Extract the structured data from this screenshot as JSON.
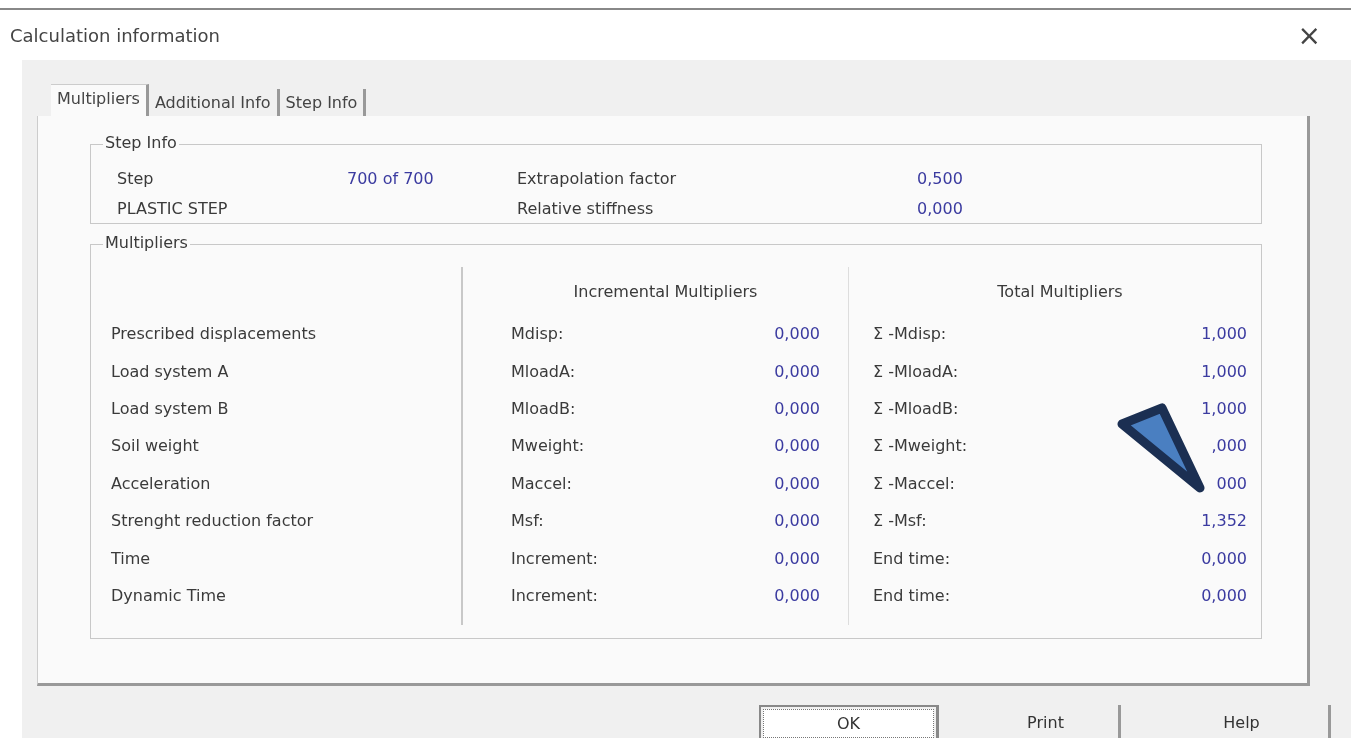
{
  "window": {
    "title": "Calculation information",
    "close": "×"
  },
  "tabs": [
    {
      "label": "Multipliers",
      "selected": true
    },
    {
      "label": "Additional Info",
      "selected": false
    },
    {
      "label": "Step Info",
      "selected": false
    }
  ],
  "step_info": {
    "title": "Step Info",
    "step_label": "Step",
    "step_value": "700 of 700",
    "phase": "PLASTIC STEP",
    "items": [
      {
        "label": "Extrapolation factor",
        "value": "0,500"
      },
      {
        "label": "Relative stiffness",
        "value": "0,000"
      }
    ]
  },
  "multipliers": {
    "title": "Multipliers",
    "incremental_header": "Incremental Multipliers",
    "total_header": "Total Multipliers",
    "rows": [
      {
        "name": "Prescribed displacements",
        "inc_label": "Mdisp:",
        "inc_value": "0,000",
        "total_label": "Σ -Mdisp:",
        "total_value": "1,000"
      },
      {
        "name": "Load system A",
        "inc_label": "MloadA:",
        "inc_value": "0,000",
        "total_label": "Σ -MloadA:",
        "total_value": "1,000"
      },
      {
        "name": "Load system B",
        "inc_label": "MloadB:",
        "inc_value": "0,000",
        "total_label": "Σ -MloadB:",
        "total_value": "1,000"
      },
      {
        "name": "Soil weight",
        "inc_label": "Mweight:",
        "inc_value": "0,000",
        "total_label": "Σ -Mweight:",
        "total_value": ",000"
      },
      {
        "name": "Acceleration",
        "inc_label": "Maccel:",
        "inc_value": "0,000",
        "total_label": "Σ -Maccel:",
        "total_value": "000"
      },
      {
        "name": "Strenght reduction factor",
        "inc_label": "Msf:",
        "inc_value": "0,000",
        "total_label": "Σ -Msf:",
        "total_value": "1,352"
      },
      {
        "name": "Time",
        "inc_label": "Increment:",
        "inc_value": "0,000",
        "total_label": "End time:",
        "total_value": "0,000"
      },
      {
        "name": "Dynamic Time",
        "inc_label": "Increment:",
        "inc_value": "0,000",
        "total_label": "End time:",
        "total_value": "0,000"
      }
    ]
  },
  "buttons": [
    {
      "label": "OK",
      "focused": true
    },
    {
      "label": "Print",
      "focused": false
    },
    {
      "label": "Help",
      "focused": false
    }
  ]
}
